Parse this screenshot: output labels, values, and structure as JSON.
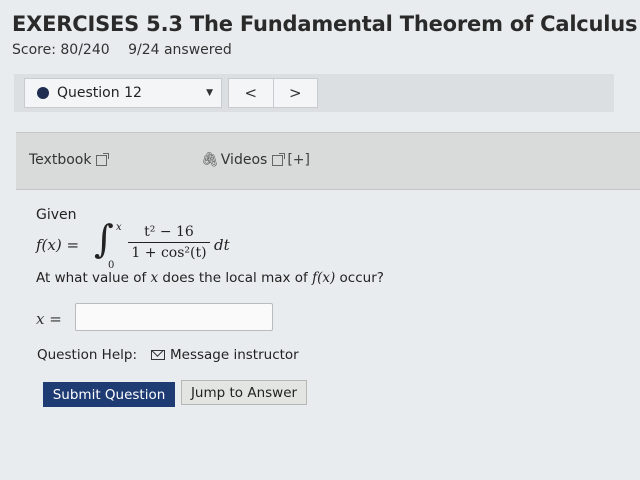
{
  "header": {
    "title": "EXERCISES 5.3 The Fundamental Theorem of Calculus",
    "score": "Score: 80/240",
    "answered": "9/24 answered"
  },
  "question_nav": {
    "selected": "Question 12",
    "prev": "<",
    "next": ">"
  },
  "resources": {
    "textbook": "Textbook",
    "videos": "Videos",
    "videos_more": "[+]"
  },
  "question": {
    "given": "Given",
    "fx": "f(x) =",
    "upper_limit": "x",
    "lower_limit": "0",
    "numerator": "t² − 16",
    "denominator": "1 + cos²(t)",
    "differential": "dt",
    "prompt_pre": "At what value of ",
    "prompt_var": "x",
    "prompt_mid": " does the local max of ",
    "prompt_fx": "f(x)",
    "prompt_post": " occur?",
    "answer_label": "x =",
    "answer_value": ""
  },
  "help": {
    "label": "Question Help:",
    "message": "Message instructor"
  },
  "actions": {
    "submit": "Submit Question",
    "jump": "Jump to Answer"
  },
  "colors": {
    "submit_bg": "#1f3b73",
    "question_dot": "#1f2d52"
  }
}
